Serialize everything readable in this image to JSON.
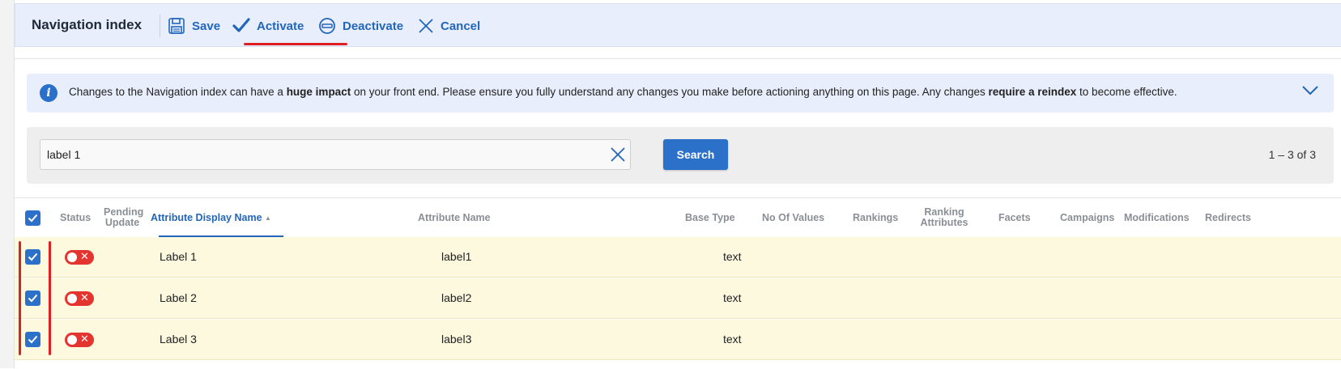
{
  "toolbar": {
    "title": "Navigation index",
    "save_label": "Save",
    "activate_label": "Activate",
    "deactivate_label": "Deactivate",
    "cancel_label": "Cancel",
    "accent_color": "#2266bb",
    "highlight_color": "#e02020"
  },
  "info_banner": {
    "text_1": "Changes to the Navigation index can have a ",
    "bold_1": "huge impact",
    "text_2": " on your front end. Please ensure you fully understand any changes you make before actioning anything on this page. Any changes ",
    "bold_2": "require a reindex",
    "text_3": " to become effective.",
    "icon": "info-icon",
    "expand_icon": "chevron-down-icon"
  },
  "search": {
    "value": "label 1",
    "button_label": "Search",
    "pagination": "1 – 3 of 3"
  },
  "table": {
    "columns": {
      "status": "Status",
      "pending_1": "Pending",
      "pending_2": "Update",
      "display_name": "Attribute Display Name",
      "attribute_name": "Attribute Name",
      "base_type": "Base Type",
      "no_of_values": "No Of Values",
      "rankings": "Rankings",
      "ranking_attr_1": "Ranking",
      "ranking_attr_2": "Attributes",
      "facets": "Facets",
      "campaigns": "Campaigns",
      "modifications": "Modifications",
      "redirects": "Redirects"
    },
    "sorted_column": "Attribute Display Name",
    "rows": [
      {
        "display_name": "Label 1",
        "attribute_name": "label1",
        "base_type": "text",
        "status": "inactive",
        "checked": true
      },
      {
        "display_name": "Label 2",
        "attribute_name": "label2",
        "base_type": "text",
        "status": "inactive",
        "checked": true
      },
      {
        "display_name": "Label 3",
        "attribute_name": "label3",
        "base_type": "text",
        "status": "inactive",
        "checked": true
      }
    ],
    "row_highlight_color": "#fcf9df"
  }
}
